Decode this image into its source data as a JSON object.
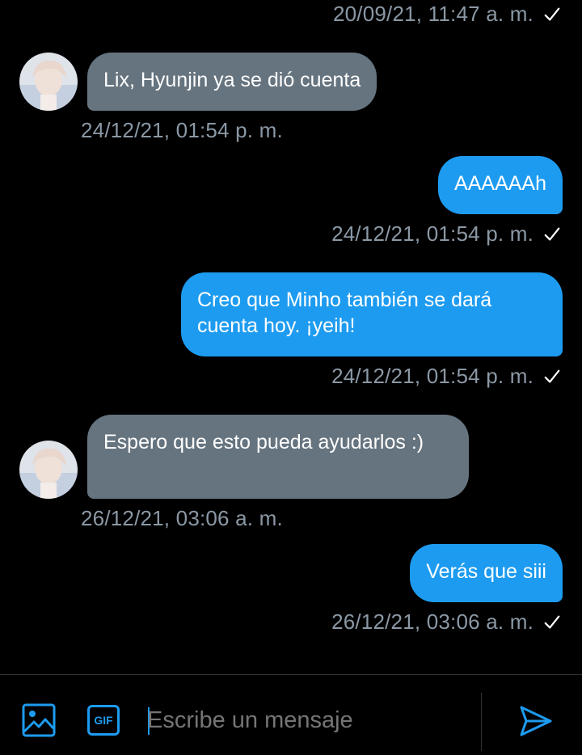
{
  "colors": {
    "accent": "#1d9bf0",
    "incoming_bubble": "#66747f",
    "timestamp": "#8b98a5",
    "background": "#000000"
  },
  "messages": [
    {
      "direction": "out",
      "text": "",
      "timestamp": "20/09/21, 11:47 a. m.",
      "read_icon": "checkmark-icon"
    },
    {
      "direction": "in",
      "text": "Lix, Hyunjin ya se dió cuenta",
      "timestamp": "24/12/21, 01:54 p. m."
    },
    {
      "direction": "out",
      "text": "AAAAAAh",
      "timestamp": "24/12/21, 01:54 p. m.",
      "read_icon": "checkmark-icon"
    },
    {
      "direction": "out",
      "text": "Creo que Minho también se dará cuenta hoy. ¡yeih!",
      "timestamp": "24/12/21, 01:54 p. m.",
      "read_icon": "checkmark-icon"
    },
    {
      "direction": "in",
      "text": "Espero que esto pueda ayudarlos :)",
      "timestamp": "26/12/21, 03:06 a. m."
    },
    {
      "direction": "out",
      "text": "Verás que siii",
      "timestamp": "26/12/21, 03:06 a. m.",
      "read_icon": "checkmark-icon"
    }
  ],
  "composer": {
    "placeholder": "Escribe un mensaje",
    "gif_label": "GIF",
    "icons": [
      "image-icon",
      "gif-icon",
      "send-icon"
    ]
  }
}
